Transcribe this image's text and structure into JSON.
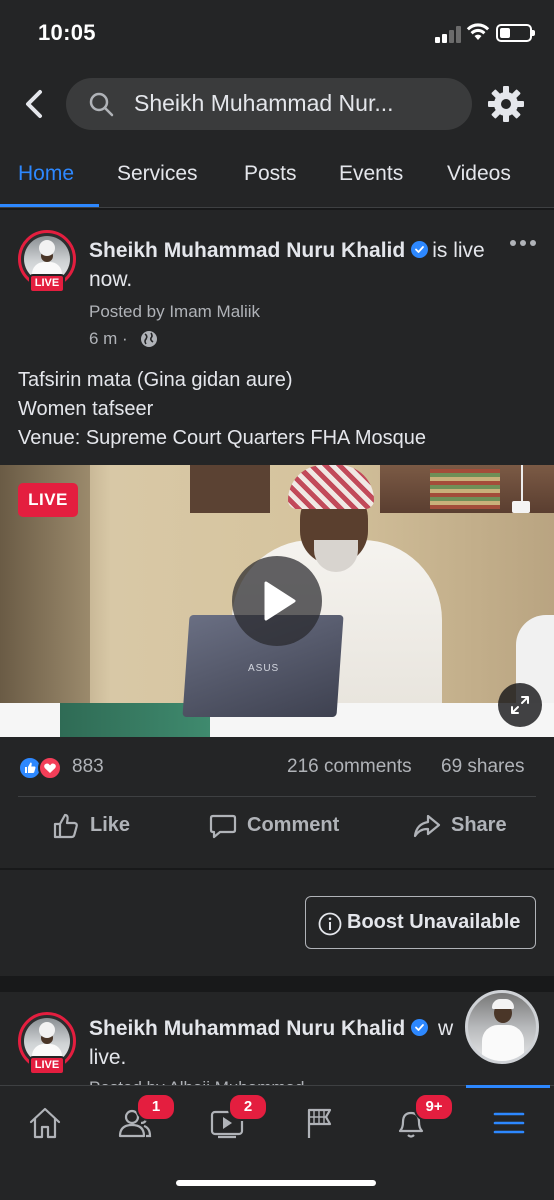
{
  "status_bar": {
    "time": "10:05",
    "battery_level": 0.35
  },
  "header": {
    "search_text": "Sheikh Muhammad Nur...",
    "back_icon": "chevron-left-icon",
    "settings_icon": "gear-icon"
  },
  "tabs": [
    {
      "label": "Home",
      "active": true
    },
    {
      "label": "Services",
      "active": false
    },
    {
      "label": "Posts",
      "active": false
    },
    {
      "label": "Events",
      "active": false
    },
    {
      "label": "Videos",
      "active": false
    }
  ],
  "post": {
    "author": "Sheikh Muhammad Nuru Khalid",
    "status_suffix": "is live now.",
    "live_label": "LIVE",
    "posted_by": "Posted by Imam Maliik",
    "time_ago": "6 m ·",
    "body_lines": [
      "Tafsirin mata (Gina gidan aure)",
      "Women tafseer",
      "Venue: Supreme Court Quarters FHA Mosque"
    ],
    "video": {
      "live_badge": "LIVE",
      "laptop_logo": "ASUS"
    },
    "reactions": {
      "count": "883",
      "comments": "216 comments",
      "shares": "69 shares"
    },
    "actions": [
      {
        "label": "Like",
        "icon": "thumbs-up-icon"
      },
      {
        "label": "Comment",
        "icon": "comment-icon"
      },
      {
        "label": "Share",
        "icon": "share-icon"
      }
    ]
  },
  "boost": {
    "label": "Boost Unavailable",
    "icon": "info-icon"
  },
  "post2": {
    "author": "Sheikh Muhammad Nuru Khalid",
    "status_suffix": "w live.",
    "live_label": "LIVE",
    "posted_by_partial": "Posted by Alhaji Muhammad"
  },
  "bottom_nav": [
    {
      "name": "home",
      "icon": "home-icon",
      "badge": ""
    },
    {
      "name": "friends",
      "icon": "friends-icon",
      "badge": "1"
    },
    {
      "name": "watch",
      "icon": "video-icon",
      "badge": "2"
    },
    {
      "name": "pages",
      "icon": "flag-icon",
      "badge": ""
    },
    {
      "name": "notifications",
      "icon": "bell-icon",
      "badge": "9+"
    },
    {
      "name": "menu",
      "icon": "menu-icon",
      "badge": "",
      "active": true
    }
  ],
  "colors": {
    "accent": "#2d88ff",
    "live": "#e41e3f",
    "background": "#18191a",
    "surface": "#242526"
  }
}
